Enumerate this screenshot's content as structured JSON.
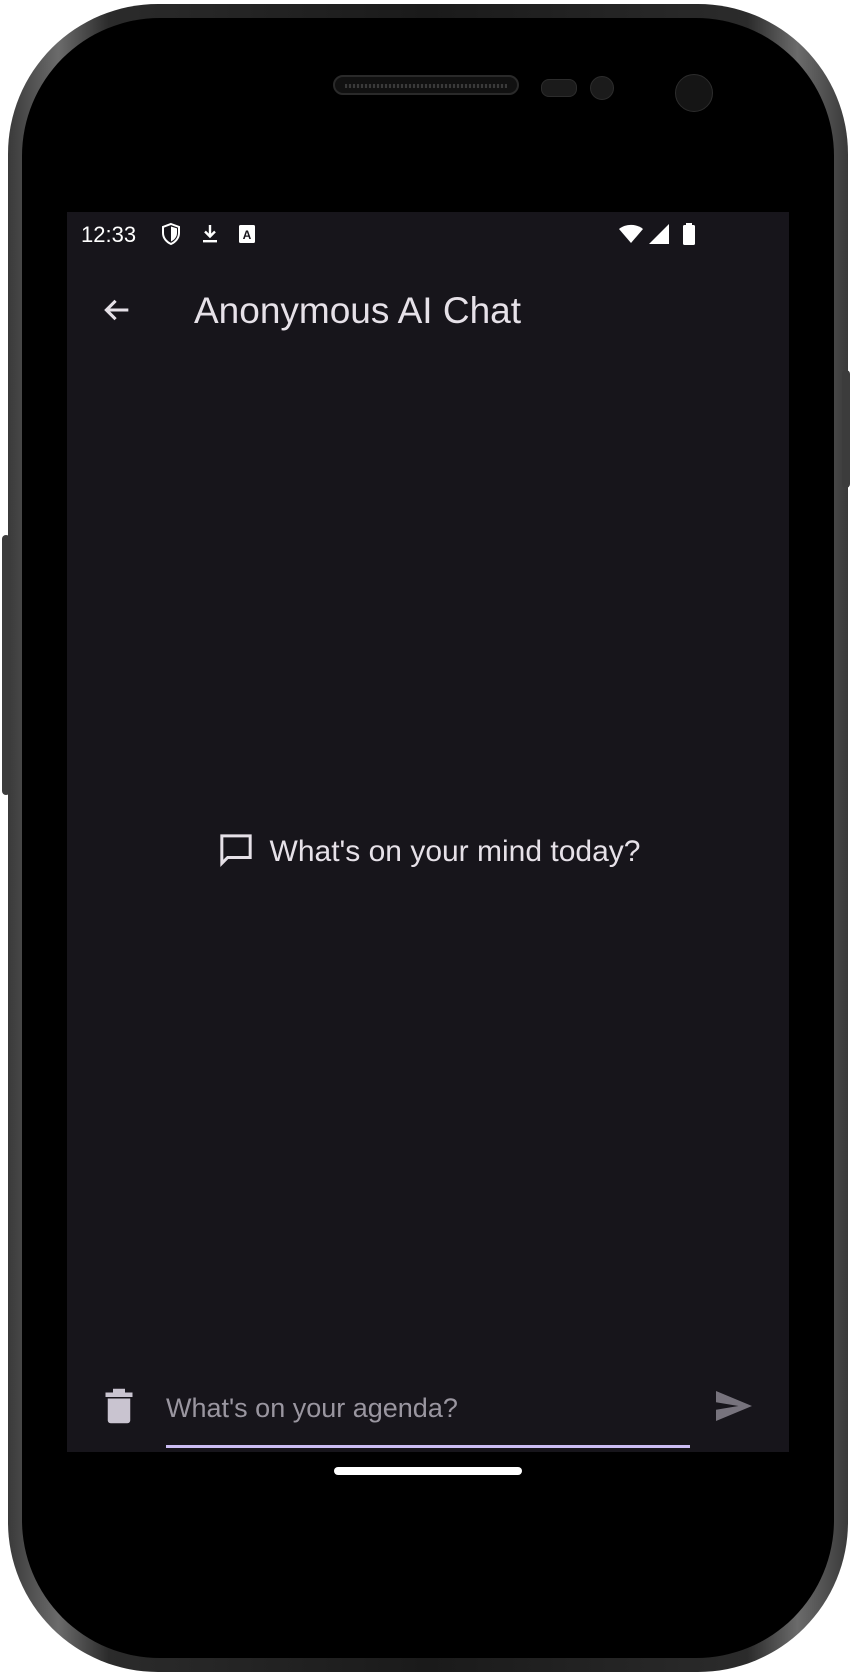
{
  "status_bar": {
    "time": "12:33",
    "left_icons": [
      "shield-icon",
      "download-icon",
      "keyboard-a-icon"
    ],
    "right_icons": [
      "wifi-icon",
      "cellular-signal-icon",
      "battery-icon"
    ]
  },
  "app_bar": {
    "back_icon": "arrow-back-icon",
    "title": "Anonymous AI Chat"
  },
  "empty_state": {
    "icon": "chat-bubble-outline-icon",
    "text": "What's on your mind today?"
  },
  "composer": {
    "delete_icon": "trash-icon",
    "value": "",
    "placeholder": "What's on your agenda?",
    "send_icon": "send-icon",
    "underline_color": "#cbbcf3"
  },
  "colors": {
    "background": "#17151b",
    "text": "#e6e1e8",
    "hint": "#9a96a0",
    "accent": "#cbbcf3"
  }
}
